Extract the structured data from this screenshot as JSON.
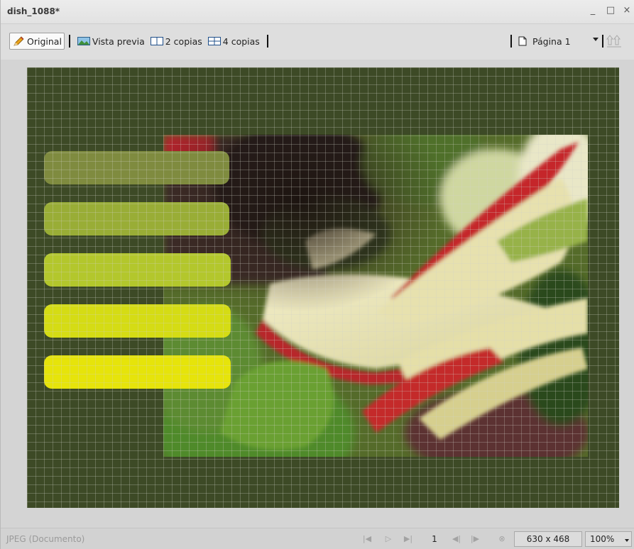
{
  "window": {
    "title": "dish_1088*",
    "minimize_glyph": "_",
    "maximize_glyph": "□",
    "close_glyph": "×"
  },
  "toolbar": {
    "original_label": "Original",
    "preview_label": "Vista previa",
    "two_copies_label": "2 copias",
    "four_copies_label": "4 copias",
    "page_label": "Página 1",
    "icons": {
      "original": "pencil-icon",
      "preview": "landscape-image-icon",
      "two_copies": "two-panel-icon",
      "four_copies": "four-panel-icon",
      "page": "page-icon",
      "upload": "upload-icon"
    }
  },
  "canvas": {
    "background_color": "#3d4a26",
    "grid": true,
    "bar_colors": [
      "#7f8b3f",
      "#99ad36",
      "#b3c72c",
      "#d5dc14",
      "#e6e40a"
    ]
  },
  "statusbar": {
    "format_text": "JPEG (Documento)",
    "page_number": "1",
    "dimensions": "630 x 468",
    "zoom": "100%",
    "nav_icons": [
      "first-page-icon",
      "play-icon",
      "last-page-icon",
      "rewind-icon",
      "forward-icon",
      "stop-icon"
    ]
  }
}
